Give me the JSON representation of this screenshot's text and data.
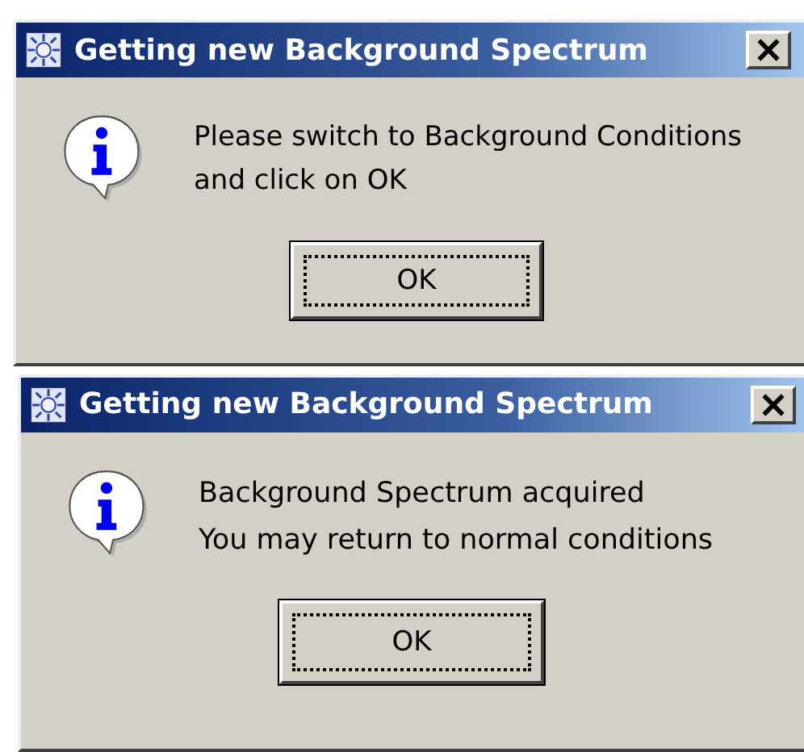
{
  "dialogs": [
    {
      "title": "Getting new Background Spectrum",
      "message_lines": [
        "Please switch to Background Conditions",
        "and click on OK"
      ],
      "button": {
        "label": "OK",
        "focused": true
      }
    },
    {
      "title": "Getting new Background Spectrum",
      "message_lines": [
        "Background Spectrum acquired",
        "You may return to normal conditions"
      ],
      "button": {
        "label": "OK",
        "focused": true
      }
    }
  ]
}
